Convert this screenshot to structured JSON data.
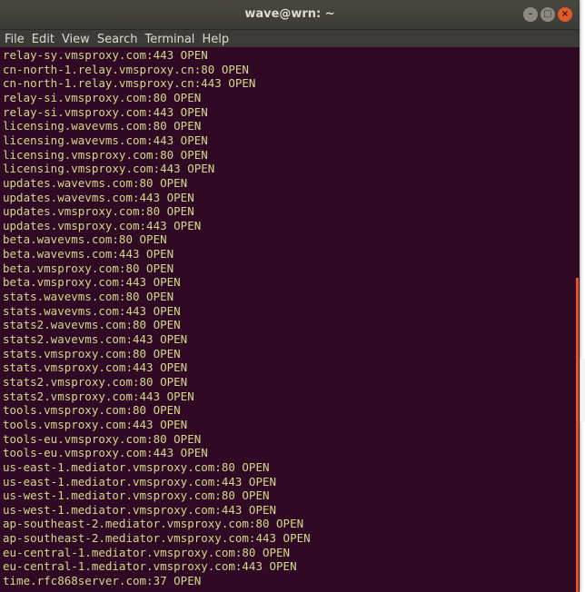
{
  "window": {
    "title": "wave@wrn: ~",
    "buttons": {
      "minimize": "–",
      "maximize": "□",
      "close": "×"
    }
  },
  "menu": [
    "File",
    "Edit",
    "View",
    "Search",
    "Terminal",
    "Help"
  ],
  "terminal": {
    "lines": [
      "relay-sy.vmsproxy.com:443 OPEN",
      "cn-north-1.relay.vmsproxy.cn:80 OPEN",
      "cn-north-1.relay.vmsproxy.cn:443 OPEN",
      "relay-si.vmsproxy.com:80 OPEN",
      "relay-si.vmsproxy.com:443 OPEN",
      "licensing.wavevms.com:80 OPEN",
      "licensing.wavevms.com:443 OPEN",
      "licensing.vmsproxy.com:80 OPEN",
      "licensing.vmsproxy.com:443 OPEN",
      "updates.wavevms.com:80 OPEN",
      "updates.wavevms.com:443 OPEN",
      "updates.vmsproxy.com:80 OPEN",
      "updates.vmsproxy.com:443 OPEN",
      "beta.wavevms.com:80 OPEN",
      "beta.wavevms.com:443 OPEN",
      "beta.vmsproxy.com:80 OPEN",
      "beta.vmsproxy.com:443 OPEN",
      "stats.wavevms.com:80 OPEN",
      "stats.wavevms.com:443 OPEN",
      "stats2.wavevms.com:80 OPEN",
      "stats2.wavevms.com:443 OPEN",
      "stats.vmsproxy.com:80 OPEN",
      "stats.vmsproxy.com:443 OPEN",
      "stats2.vmsproxy.com:80 OPEN",
      "stats2.vmsproxy.com:443 OPEN",
      "tools.vmsproxy.com:80 OPEN",
      "tools.vmsproxy.com:443 OPEN",
      "tools-eu.vmsproxy.com:80 OPEN",
      "tools-eu.vmsproxy.com:443 OPEN",
      "us-east-1.mediator.vmsproxy.com:80 OPEN",
      "us-east-1.mediator.vmsproxy.com:443 OPEN",
      "us-west-1.mediator.vmsproxy.com:80 OPEN",
      "us-west-1.mediator.vmsproxy.com:443 OPEN",
      "ap-southeast-2.mediator.vmsproxy.com:80 OPEN",
      "ap-southeast-2.mediator.vmsproxy.com:443 OPEN",
      "eu-central-1.mediator.vmsproxy.com:80 OPEN",
      "eu-central-1.mediator.vmsproxy.com:443 OPEN",
      "time.rfc868server.com:37 OPEN"
    ]
  },
  "colors": {
    "terminal_background": "#300a24",
    "terminal_text": "#d3d78e",
    "titlebar": "#3c3b37",
    "scrollbar_thumb": "#e95420",
    "close_button": "#e25a2b"
  }
}
